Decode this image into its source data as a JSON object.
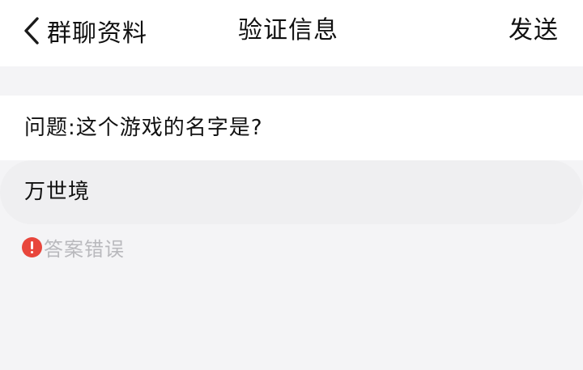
{
  "nav": {
    "back_label": "群聊资料",
    "title": "验证信息",
    "send_label": "发送"
  },
  "question": {
    "text": "问题:这个游戏的名字是?"
  },
  "answer": {
    "value": "万世境"
  },
  "error": {
    "message": "答案错误",
    "icon": "exclamation-circle-icon"
  },
  "colors": {
    "error": "#e8463c",
    "page_background": "#f4f4f6",
    "answer_background": "#efeff1",
    "muted_text": "#b9b9bd"
  }
}
